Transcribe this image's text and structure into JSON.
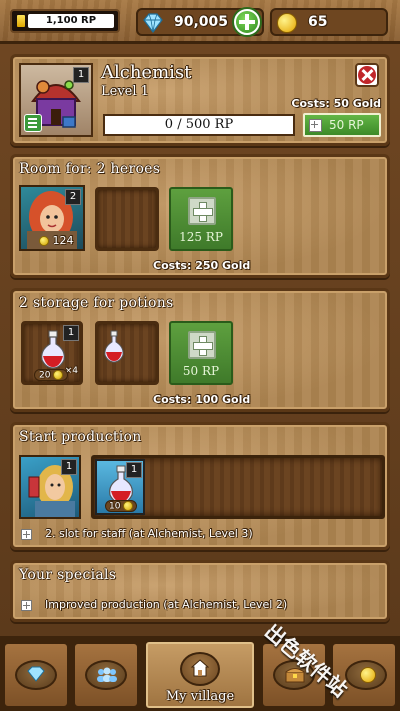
{
  "topbar": {
    "rp_value": "1,100 RP",
    "gems": "90,005",
    "gold": "65"
  },
  "building": {
    "name": "Alchemist",
    "level": "Level 1",
    "badge": "1",
    "upgrade_cost": "Costs: 50 Gold",
    "progress_text": "0 / 500 RP",
    "progress_fraction": 0,
    "upgrade_button": "50 RP"
  },
  "heroes": {
    "title": "Room for: 2 heroes",
    "hero_level": "2",
    "hero_value": "124",
    "add_label": "125 RP",
    "cost": "Costs: 250 Gold"
  },
  "storage": {
    "title": "2 storage for potions",
    "slot1_badge": "1",
    "slot1_count": "×4",
    "slot1_price": "20",
    "add_label": "50 RP",
    "cost": "Costs: 100 Gold"
  },
  "production": {
    "title": "Start production",
    "staff_badge": "1",
    "potion_badge": "1",
    "potion_price": "10",
    "slot_note": "2. slot for staff (at Alchemist, Level 3)"
  },
  "specials": {
    "title": "Your specials",
    "item": "Improved production (at Alchemist, Level 2)"
  },
  "nav": {
    "village_label": "My village"
  },
  "watermark": "出色软件站",
  "colors": {
    "accent_green": "#4f9a35",
    "progress_bg": "#ffffff",
    "close_red": "#c0262a"
  }
}
